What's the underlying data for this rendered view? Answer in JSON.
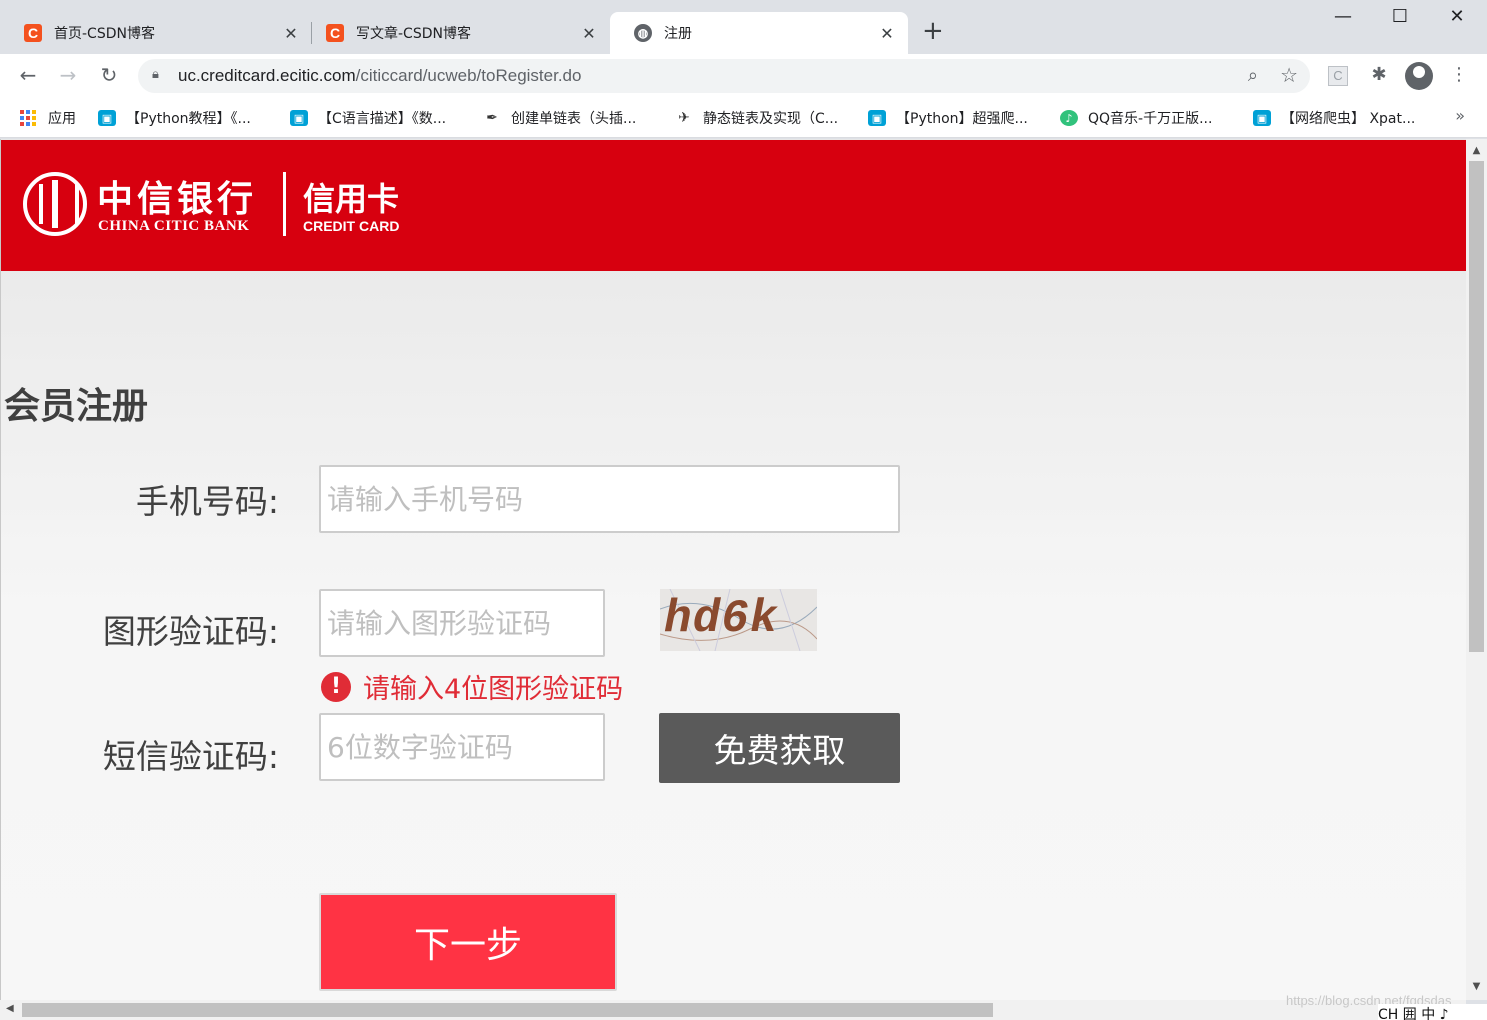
{
  "browser": {
    "tabs": [
      {
        "title": "首页-CSDN博客",
        "favicon": "csdn-c-icon",
        "active": false
      },
      {
        "title": "写文章-CSDN博客",
        "favicon": "csdn-c-icon",
        "active": false
      },
      {
        "title": "注册",
        "favicon": "globe-icon",
        "active": true
      }
    ],
    "close_glyph": "✕",
    "new_tab_glyph": "+",
    "window": {
      "minimize": "—",
      "maximize": "☐",
      "close": "✕"
    },
    "nav": {
      "back": "←",
      "forward": "→",
      "reload": "↻"
    },
    "url_host": "uc.creditcard.ecitic.com",
    "url_path": "/citiccard/ucweb/toRegister.do",
    "icons": {
      "lock": "lock-icon",
      "zoom": "zoom-icon",
      "star": "bookmark-star-icon",
      "extensions": "puzzle-icon",
      "menu": "kebab-menu-icon"
    },
    "bookmarks": [
      {
        "label": "应用",
        "icon": "apps-grid-icon"
      },
      {
        "label": "【Python教程】《...",
        "icon": "bilibili-tv-icon"
      },
      {
        "label": "【C语言描述】《数...",
        "icon": "bilibili-tv-icon"
      },
      {
        "label": "创建单链表（头插...",
        "icon": "ink-pen-icon"
      },
      {
        "label": "静态链表及实现（C...",
        "icon": "bird-icon"
      },
      {
        "label": "【Python】超强爬...",
        "icon": "bilibili-tv-icon"
      },
      {
        "label": "QQ音乐-千万正版...",
        "icon": "qq-music-icon"
      },
      {
        "label": "【网络爬虫】 Xpat...",
        "icon": "bilibili-tv-icon"
      }
    ],
    "bookmarks_more": "»"
  },
  "page": {
    "brand": {
      "bank_cn": "中信银行",
      "bank_en": "CHINA CITIC BANK",
      "product_cn": "信用卡",
      "product_en": "CREDIT CARD",
      "header_color": "#d7000f"
    },
    "title": "会员注册",
    "form": {
      "phone_label": "手机号码:",
      "phone_placeholder": "请输入手机号码",
      "captcha_label": "图形验证码:",
      "captcha_placeholder": "请输入图形验证码",
      "captcha_image_text": "hd6k",
      "captcha_error": "请输入4位图形验证码",
      "sms_label": "短信验证码:",
      "sms_placeholder": "6位数字验证码",
      "sms_button": "免费获取",
      "next_button": "下一步"
    },
    "colors": {
      "error": "#e02c36",
      "next_button": "#ff3344",
      "sms_button": "#5a5a5a"
    }
  },
  "watermark": "https://blog.csdn.net/fgdsdas",
  "ime_bar": "CH 囲 中 ♪"
}
